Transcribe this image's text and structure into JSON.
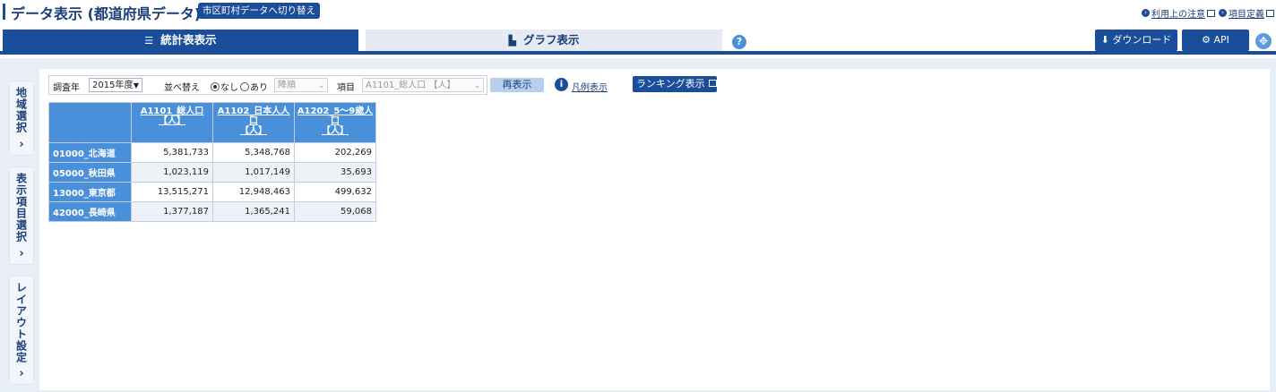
{
  "header": {
    "title": "データ表示 (都道府県データ)",
    "switch_button": "市区町村データへ切り替え",
    "links": [
      "利用上の注意",
      "項目定義"
    ]
  },
  "tabs": [
    {
      "label": "統計表表示",
      "active": true,
      "icon": "table-icon"
    },
    {
      "label": "グラフ表示",
      "active": false,
      "icon": "bar-chart-icon"
    }
  ],
  "toolbar": {
    "download_label": "ダウンロード",
    "api_label": "API"
  },
  "side_tabs": [
    "地域選択",
    "表示項目選択",
    "レイアウト設定"
  ],
  "controls": {
    "year_label": "調査年",
    "year_value": "2015年度",
    "sort_label": "並べ替え",
    "sort_none": "なし",
    "sort_yes": "あり",
    "order_value": "降順",
    "item_label": "項目",
    "item_value": "A1101_総人口 【人】",
    "redisplay_label": "再表示",
    "legend_label": "凡例表示",
    "ranking_label": "ランキング表示"
  },
  "table": {
    "columns": [
      {
        "l1": "A1101_総人口",
        "l2": "【人】"
      },
      {
        "l1": "A1102_日本人人",
        "l2": "口",
        "l3": "【人】"
      },
      {
        "l1": "A1202_5～9歳人",
        "l2": "口",
        "l3": "【人】"
      }
    ],
    "rows": [
      {
        "region": "01000_北海道",
        "values": [
          "5,381,733",
          "5,348,768",
          "202,269"
        ]
      },
      {
        "region": "05000_秋田県",
        "values": [
          "1,023,119",
          "1,017,149",
          "35,693"
        ]
      },
      {
        "region": "13000_東京都",
        "values": [
          "13,515,271",
          "12,948,463",
          "499,632"
        ]
      },
      {
        "region": "42000_長崎県",
        "values": [
          "1,377,187",
          "1,365,241",
          "59,068"
        ]
      }
    ]
  },
  "colors": {
    "primary": "#1a4e9b",
    "table_header": "#4a8fd9",
    "background": "#e8eef6"
  }
}
